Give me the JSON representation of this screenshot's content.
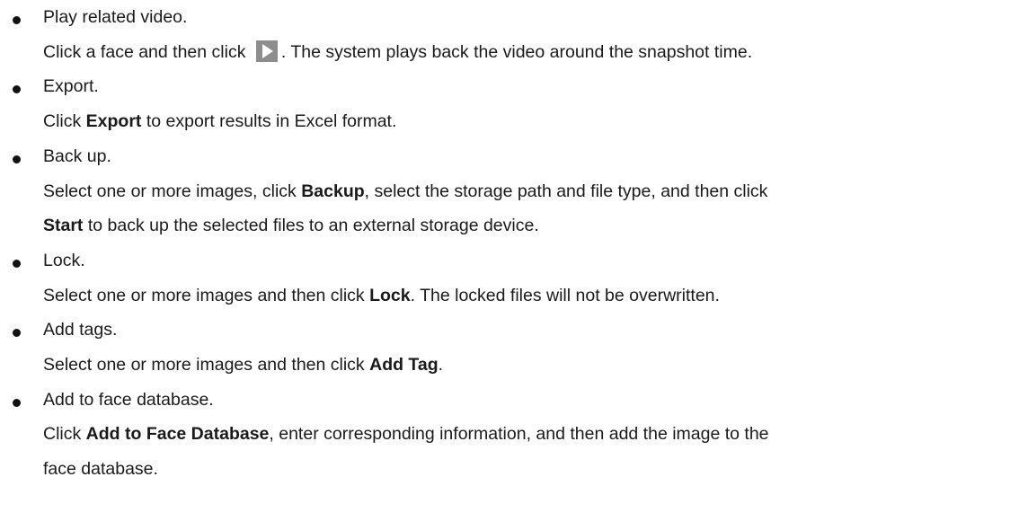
{
  "items": [
    {
      "heading": "Play related video.",
      "desc": {
        "part1": "Click a face and then click ",
        "icon": "play-icon",
        "part2": ". The system plays back the video around the snapshot time."
      }
    },
    {
      "heading": "Export.",
      "desc": {
        "pre": "Click ",
        "bold": "Export",
        "post": " to export results in Excel format."
      }
    },
    {
      "heading": "Back up.",
      "desc": {
        "line1_pre": "Select one or more images, click ",
        "line1_bold": "Backup",
        "line1_post": ", select the storage path and file type, and then click",
        "line2_bold": "Start",
        "line2_post": " to back up the selected files to an external storage device."
      }
    },
    {
      "heading": "Lock.",
      "desc": {
        "pre": "Select one or more images and then click ",
        "bold": "Lock",
        "post": ". The locked files will not be overwritten."
      }
    },
    {
      "heading": "Add tags.",
      "desc": {
        "pre": "Select one or more images and then click ",
        "bold": "Add Tag",
        "post": "."
      }
    },
    {
      "heading": "Add to face database.",
      "desc": {
        "line1_pre": "Click ",
        "line1_bold": "Add to Face Database",
        "line1_post": ", enter corresponding information, and then add the image to the",
        "line2_text": "face database."
      }
    }
  ]
}
